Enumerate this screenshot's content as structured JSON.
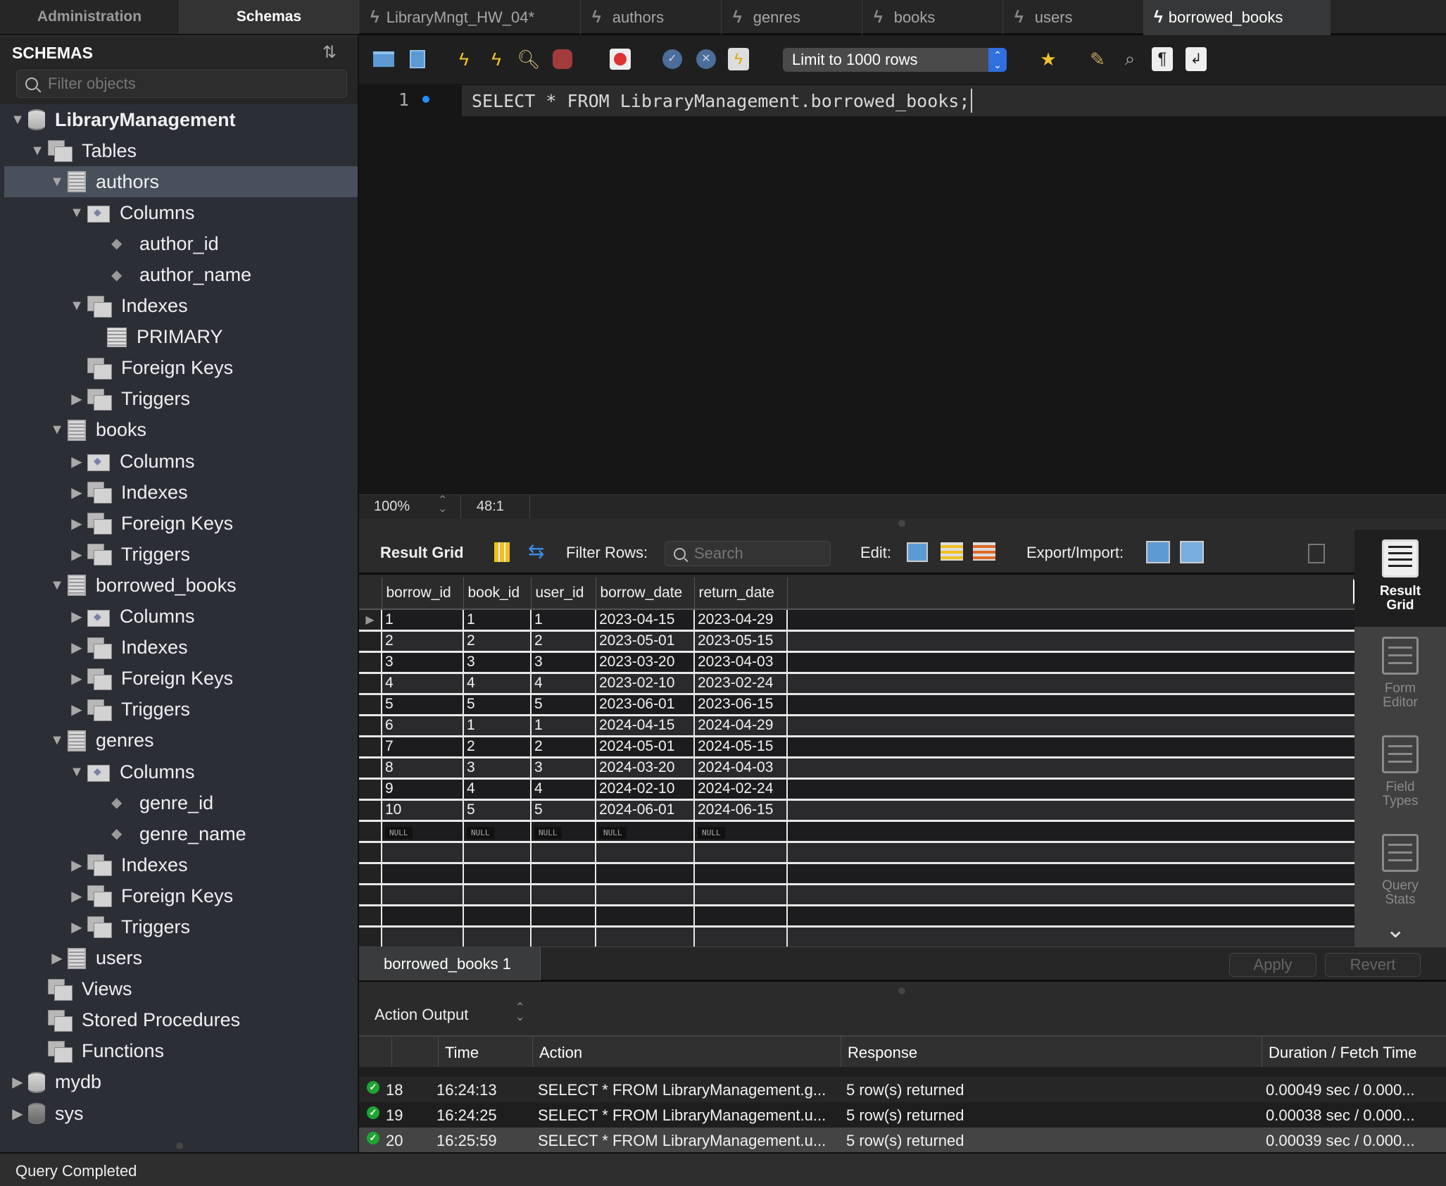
{
  "sidebar": {
    "tabs": [
      {
        "label": "Administration",
        "active": false
      },
      {
        "label": "Schemas",
        "active": true
      }
    ],
    "title": "SCHEMAS",
    "filter_placeholder": "Filter objects",
    "tree": [
      {
        "label": "LibraryManagement",
        "level": 0,
        "expanded": true,
        "icon": "database-icon",
        "bold": true
      },
      {
        "label": "Tables",
        "level": 1,
        "expanded": true,
        "icon": "tables-group-icon"
      },
      {
        "label": "authors",
        "level": 2,
        "expanded": true,
        "icon": "table-icon",
        "selected": true
      },
      {
        "label": "Columns",
        "level": 3,
        "expanded": true,
        "icon": "columns-folder-icon"
      },
      {
        "label": "author_id",
        "level": 4,
        "icon": "column-icon"
      },
      {
        "label": "author_name",
        "level": 4,
        "icon": "column-icon"
      },
      {
        "label": "Indexes",
        "level": 3,
        "expanded": true,
        "icon": "indexes-group-icon"
      },
      {
        "label": "PRIMARY",
        "level": 4,
        "icon": "index-icon"
      },
      {
        "label": "Foreign Keys",
        "level": 3,
        "icon": "foreign-keys-group-icon"
      },
      {
        "label": "Triggers",
        "level": 3,
        "expanded": false,
        "icon": "triggers-group-icon"
      },
      {
        "label": "books",
        "level": 2,
        "expanded": true,
        "icon": "table-icon"
      },
      {
        "label": "Columns",
        "level": 3,
        "expanded": false,
        "icon": "columns-folder-icon"
      },
      {
        "label": "Indexes",
        "level": 3,
        "expanded": false,
        "icon": "indexes-group-icon"
      },
      {
        "label": "Foreign Keys",
        "level": 3,
        "expanded": false,
        "icon": "foreign-keys-group-icon"
      },
      {
        "label": "Triggers",
        "level": 3,
        "expanded": false,
        "icon": "triggers-group-icon"
      },
      {
        "label": "borrowed_books",
        "level": 2,
        "expanded": true,
        "icon": "table-icon"
      },
      {
        "label": "Columns",
        "level": 3,
        "expanded": false,
        "icon": "columns-folder-icon"
      },
      {
        "label": "Indexes",
        "level": 3,
        "expanded": false,
        "icon": "indexes-group-icon"
      },
      {
        "label": "Foreign Keys",
        "level": 3,
        "expanded": false,
        "icon": "foreign-keys-group-icon"
      },
      {
        "label": "Triggers",
        "level": 3,
        "expanded": false,
        "icon": "triggers-group-icon"
      },
      {
        "label": "genres",
        "level": 2,
        "expanded": true,
        "icon": "table-icon"
      },
      {
        "label": "Columns",
        "level": 3,
        "expanded": true,
        "icon": "columns-folder-icon"
      },
      {
        "label": "genre_id",
        "level": 4,
        "icon": "column-icon"
      },
      {
        "label": "genre_name",
        "level": 4,
        "icon": "column-icon"
      },
      {
        "label": "Indexes",
        "level": 3,
        "expanded": false,
        "icon": "indexes-group-icon"
      },
      {
        "label": "Foreign Keys",
        "level": 3,
        "expanded": false,
        "icon": "foreign-keys-group-icon"
      },
      {
        "label": "Triggers",
        "level": 3,
        "expanded": false,
        "icon": "triggers-group-icon"
      },
      {
        "label": "users",
        "level": 2,
        "expanded": false,
        "icon": "table-icon"
      },
      {
        "label": "Views",
        "level": 1,
        "icon": "views-group-icon"
      },
      {
        "label": "Stored Procedures",
        "level": 1,
        "icon": "procedures-group-icon"
      },
      {
        "label": "Functions",
        "level": 1,
        "icon": "functions-group-icon"
      },
      {
        "label": "mydb",
        "level": 0,
        "expanded": false,
        "icon": "database-icon"
      },
      {
        "label": "sys",
        "level": 0,
        "expanded": false,
        "icon": "database-icon",
        "dim": true
      }
    ]
  },
  "query_tabs": [
    {
      "label": "LibraryMngt_HW_04*",
      "active": false
    },
    {
      "label": "authors",
      "active": false
    },
    {
      "label": "genres",
      "active": false
    },
    {
      "label": "books",
      "active": false
    },
    {
      "label": "users",
      "active": false
    },
    {
      "label": "borrowed_books",
      "active": true
    }
  ],
  "toolbar": {
    "limit_select": "Limit to 1000 rows",
    "icons": [
      "open-file-icon",
      "save-icon",
      "execute-icon",
      "execute-current-icon",
      "explain-icon",
      "stop-icon",
      "toggle-error-stop-icon",
      "commit-icon",
      "rollback-icon",
      "autocommit-icon",
      "add-snippet-icon",
      "beautify-icon",
      "find-icon",
      "invisible-chars-icon",
      "word-wrap-icon"
    ]
  },
  "editor": {
    "line_number": "1",
    "sql": "SELECT * FROM LibraryManagement.borrowed_books;",
    "zoom": "100%",
    "cursor_position": "48:1"
  },
  "result": {
    "title": "Result Grid",
    "filter_label": "Filter Rows:",
    "search_placeholder": "Search",
    "edit_label": "Edit:",
    "export_label": "Export/Import:",
    "columns": [
      "borrow_id",
      "book_id",
      "user_id",
      "borrow_date",
      "return_date"
    ],
    "rows": [
      [
        "1",
        "1",
        "1",
        "2023-04-15",
        "2023-04-29"
      ],
      [
        "2",
        "2",
        "2",
        "2023-05-01",
        "2023-05-15"
      ],
      [
        "3",
        "3",
        "3",
        "2023-03-20",
        "2023-04-03"
      ],
      [
        "4",
        "4",
        "4",
        "2023-02-10",
        "2023-02-24"
      ],
      [
        "5",
        "5",
        "5",
        "2023-06-01",
        "2023-06-15"
      ],
      [
        "6",
        "1",
        "1",
        "2024-04-15",
        "2024-04-29"
      ],
      [
        "7",
        "2",
        "2",
        "2024-05-01",
        "2024-05-15"
      ],
      [
        "8",
        "3",
        "3",
        "2024-03-20",
        "2024-04-03"
      ],
      [
        "9",
        "4",
        "4",
        "2024-02-10",
        "2024-02-24"
      ],
      [
        "10",
        "5",
        "5",
        "2024-06-01",
        "2024-06-15"
      ]
    ],
    "null_label": "NULL",
    "side_panel": [
      {
        "label_1": "Result",
        "label_2": "Grid",
        "active": true
      },
      {
        "label_1": "Form",
        "label_2": "Editor",
        "active": false
      },
      {
        "label_1": "Field",
        "label_2": "Types",
        "active": false
      },
      {
        "label_1": "Query",
        "label_2": "Stats",
        "active": false
      }
    ],
    "result_tab": "borrowed_books 1",
    "apply_label": "Apply",
    "revert_label": "Revert"
  },
  "output": {
    "title": "Action Output",
    "columns": [
      "",
      "Time",
      "Action",
      "Response",
      "Duration / Fetch Time"
    ],
    "rows": [
      {
        "num": "18",
        "time": "16:24:13",
        "action": "SELECT * FROM LibraryManagement.g...",
        "response": "5 row(s) returned",
        "duration": "0.00049 sec / 0.000...",
        "status": "success"
      },
      {
        "num": "19",
        "time": "16:24:25",
        "action": "SELECT * FROM LibraryManagement.u...",
        "response": "5 row(s) returned",
        "duration": "0.00038 sec / 0.000...",
        "status": "success"
      },
      {
        "num": "20",
        "time": "16:25:59",
        "action": "SELECT * FROM LibraryManagement.u...",
        "response": "5 row(s) returned",
        "duration": "0.00039 sec / 0.000...",
        "status": "success"
      }
    ]
  },
  "status_bar": "Query Completed",
  "colors": {
    "accent": "#2f6fdf",
    "success": "#1ea533",
    "selection": "#48505c"
  }
}
